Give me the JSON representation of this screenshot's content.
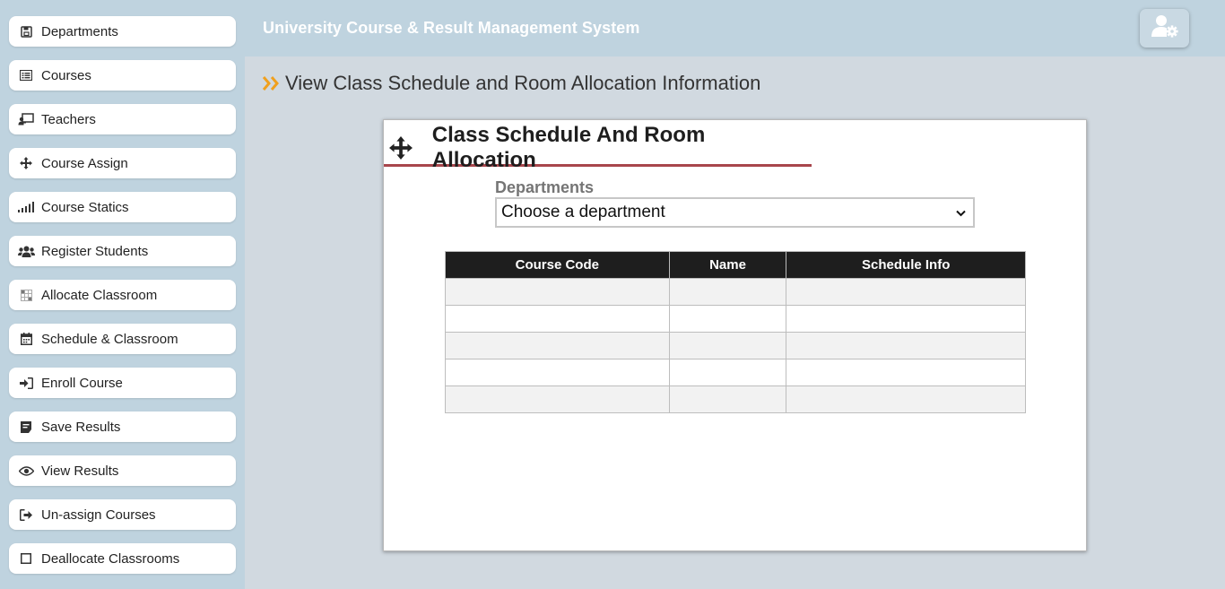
{
  "header": {
    "title": "University Course & Result Management System",
    "admin_icon": "user-gear-icon"
  },
  "sidebar": {
    "items": [
      {
        "label": "Departments",
        "icon": "save-icon"
      },
      {
        "label": "Courses",
        "icon": "list-icon"
      },
      {
        "label": "Teachers",
        "icon": "chalkboard-teacher-icon"
      },
      {
        "label": "Course Assign",
        "icon": "move-arrows-icon"
      },
      {
        "label": "Course Statics",
        "icon": "signal-bars-icon"
      },
      {
        "label": "Register Students",
        "icon": "users-icon"
      },
      {
        "label": "Allocate Classroom",
        "icon": "grid-icon"
      },
      {
        "label": "Schedule & Classroom",
        "icon": "calendar-icon"
      },
      {
        "label": "Enroll Course",
        "icon": "sign-in-icon"
      },
      {
        "label": "Save Results",
        "icon": "file-text-icon"
      },
      {
        "label": "View Results",
        "icon": "eye-icon"
      },
      {
        "label": "Un-assign Courses",
        "icon": "sign-out-icon"
      },
      {
        "label": "Deallocate Classrooms",
        "icon": "square-icon"
      }
    ]
  },
  "main": {
    "heading": "View Class Schedule and Room Allocation Information",
    "card": {
      "title": "Class Schedule And Room Allocation",
      "departments_label": "Departments",
      "department_select": {
        "selected": "Choose a department"
      },
      "table": {
        "columns": [
          "Course Code",
          "Name",
          "Schedule Info"
        ],
        "rows": [
          [
            "",
            "",
            ""
          ],
          [
            "",
            "",
            ""
          ],
          [
            "",
            "",
            ""
          ],
          [
            "",
            "",
            ""
          ],
          [
            "",
            "",
            ""
          ]
        ]
      }
    }
  },
  "colors": {
    "sidebar_bg": "#bfd3df",
    "content_bg": "#d1d9e0",
    "accent_orange": "#f0a01e",
    "title_underline": "#a8464c",
    "table_header_bg": "#1e1e1e"
  }
}
